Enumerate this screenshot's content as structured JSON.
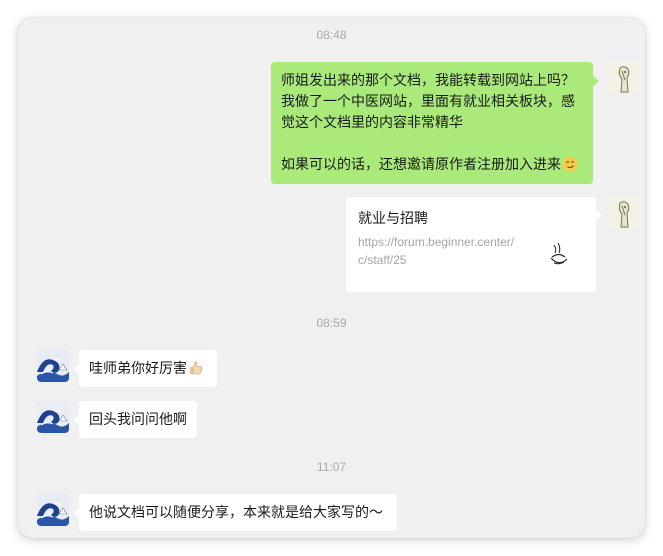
{
  "chat": {
    "timestamps": [
      "08:48",
      "08:59",
      "11:07"
    ],
    "messages": {
      "m1_lines": [
        "师姐发出来的那个文档，我能转载到网站上吗？",
        "我做了一个中医网站，里面有就业相关板块，感",
        "觉这个文档里的内容非常精华",
        "如果可以的话，还想邀请原作者注册加入进来"
      ],
      "m2": "哇师弟你好厉害",
      "m3": "回头我问问他啊",
      "m4": "他说文档可以随便分享，本来就是给大家写的～"
    },
    "link_card": {
      "title": "就业与招聘",
      "url_line1": "https://forum.beginner.center/",
      "url_line2": "c/staff/25"
    },
    "emojis": {
      "m1_end": "smirk-face-emoji",
      "m2_end": "thumbs-up-emoji"
    },
    "avatars": {
      "self": "sketch-figure-avatar",
      "other": "blue-wave-painting-avatar"
    }
  },
  "colors": {
    "background": "#f0f0f0",
    "self_bubble": "#a9ea7a",
    "other_bubble": "#ffffff",
    "timestamp": "#a8a8a8"
  }
}
